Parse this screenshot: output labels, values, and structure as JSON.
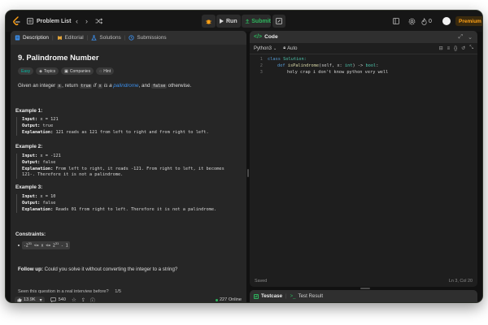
{
  "topbar": {
    "problem_list": "Problem List",
    "run": "Run",
    "submit": "Submit",
    "streak": "0",
    "premium": "Premium"
  },
  "description": {
    "tabs": [
      "Description",
      "Editorial",
      "Solutions",
      "Submissions"
    ],
    "title": "9. Palindrome Number",
    "chips": [
      "Easy",
      "Topics",
      "Companies",
      "Hint"
    ],
    "intro": {
      "p1": "Given an integer ",
      "c1": "x",
      "p2": ", return ",
      "c2": "true",
      "p3": " if ",
      "c3": "x",
      "p4": " is a ",
      "link": "palindrome",
      "p5": ", and ",
      "c4": "false",
      "p6": " otherwise."
    },
    "examples": [
      {
        "head": "Example 1:",
        "input_label": "Input:",
        "input": "x = 121",
        "output_label": "Output:",
        "output": "true",
        "expl_label": "Explanation:",
        "expl": "121 reads as 121 from left to right and from right to left."
      },
      {
        "head": "Example 2:",
        "input_label": "Input:",
        "input": "x = -121",
        "output_label": "Output:",
        "output": "false",
        "expl_label": "Explanation:",
        "expl": "From left to right, it reads -121. From right to left, it becomes",
        "expl2": "121-. Therefore it is not a palindrome."
      },
      {
        "head": "Example 3:",
        "input_label": "Input:",
        "input": "x = 10",
        "output_label": "Output:",
        "output": "false",
        "expl_label": "Explanation:",
        "expl": "Reads 01 from right to left. Therefore it is not a palindrome."
      }
    ],
    "constraints_head": "Constraints:",
    "constraint": {
      "a": "-2",
      "a_sup": "31",
      "b": " <= x <= 2",
      "b_sup": "31",
      "c": " - 1"
    },
    "followup_label": "Follow up:",
    "followup": " Could you solve it without converting the integer to a string?",
    "interview_q": "Seen this question in a real interview before?",
    "interview_page": "1/5",
    "likes": "13.9K",
    "comments": "540",
    "online": "227 Online"
  },
  "code": {
    "title": "Code",
    "language": "Python3",
    "mode": "Auto",
    "line_numbers": [
      "1",
      "2",
      "3"
    ],
    "lines": {
      "l1_kw": "class",
      "l1_name": " Solution:",
      "l2_kw": "def",
      "l2_fn": " isPalindrome",
      "l2_a": "(self, x: ",
      "l2_t1": "int",
      "l2_b": ") -> ",
      "l2_t2": "bool",
      "l2_c": ":",
      "l3": "holy crap i don't know python very well"
    },
    "status": "Saved",
    "cursor": "Ln 3, Col 20"
  },
  "testcase": {
    "tab1": "Testcase",
    "tab2": "Test Result"
  },
  "colors": {
    "submit": "#2db55d",
    "premium": "#ffa116",
    "easy": "#00b8a3",
    "link": "#3b8eea"
  }
}
